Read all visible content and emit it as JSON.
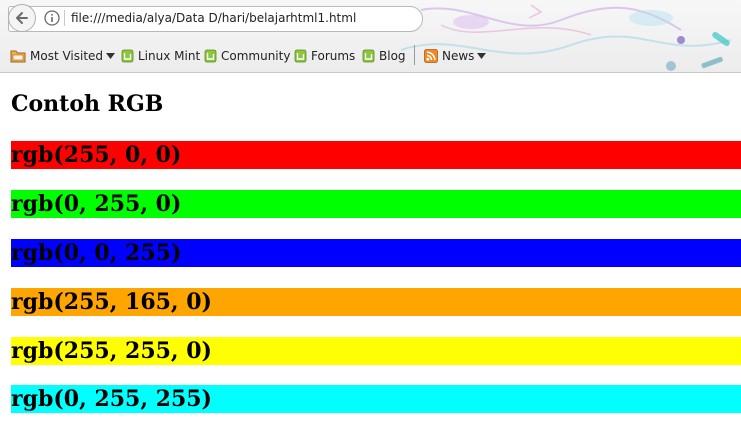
{
  "browser": {
    "url": "file:///media/alya/Data D/hari/belajarhtml1.html",
    "bookmarks": [
      {
        "label": "Most Visited",
        "icon": "folder-icon"
      },
      {
        "label": "Linux Mint",
        "icon": "mint-icon"
      },
      {
        "label": "Community",
        "icon": "mint-icon"
      },
      {
        "label": "Forums",
        "icon": "mint-icon"
      },
      {
        "label": "Blog",
        "icon": "mint-icon"
      },
      {
        "label": "News",
        "icon": "rss-icon"
      }
    ]
  },
  "page": {
    "heading": "Contoh RGB",
    "colors": [
      {
        "label": "rgb(255, 0, 0)",
        "color": "#ff0000"
      },
      {
        "label": "rgb(0, 255, 0)",
        "color": "#00ff00"
      },
      {
        "label": "rgb(0, 0, 255)",
        "color": "#0000ff"
      },
      {
        "label": "rgb(255, 165, 0)",
        "color": "#ffa500"
      },
      {
        "label": "rgb(255, 255, 0)",
        "color": "#ffff00"
      },
      {
        "label": "rgb(0, 255, 255)",
        "color": "#00ffff"
      }
    ]
  }
}
